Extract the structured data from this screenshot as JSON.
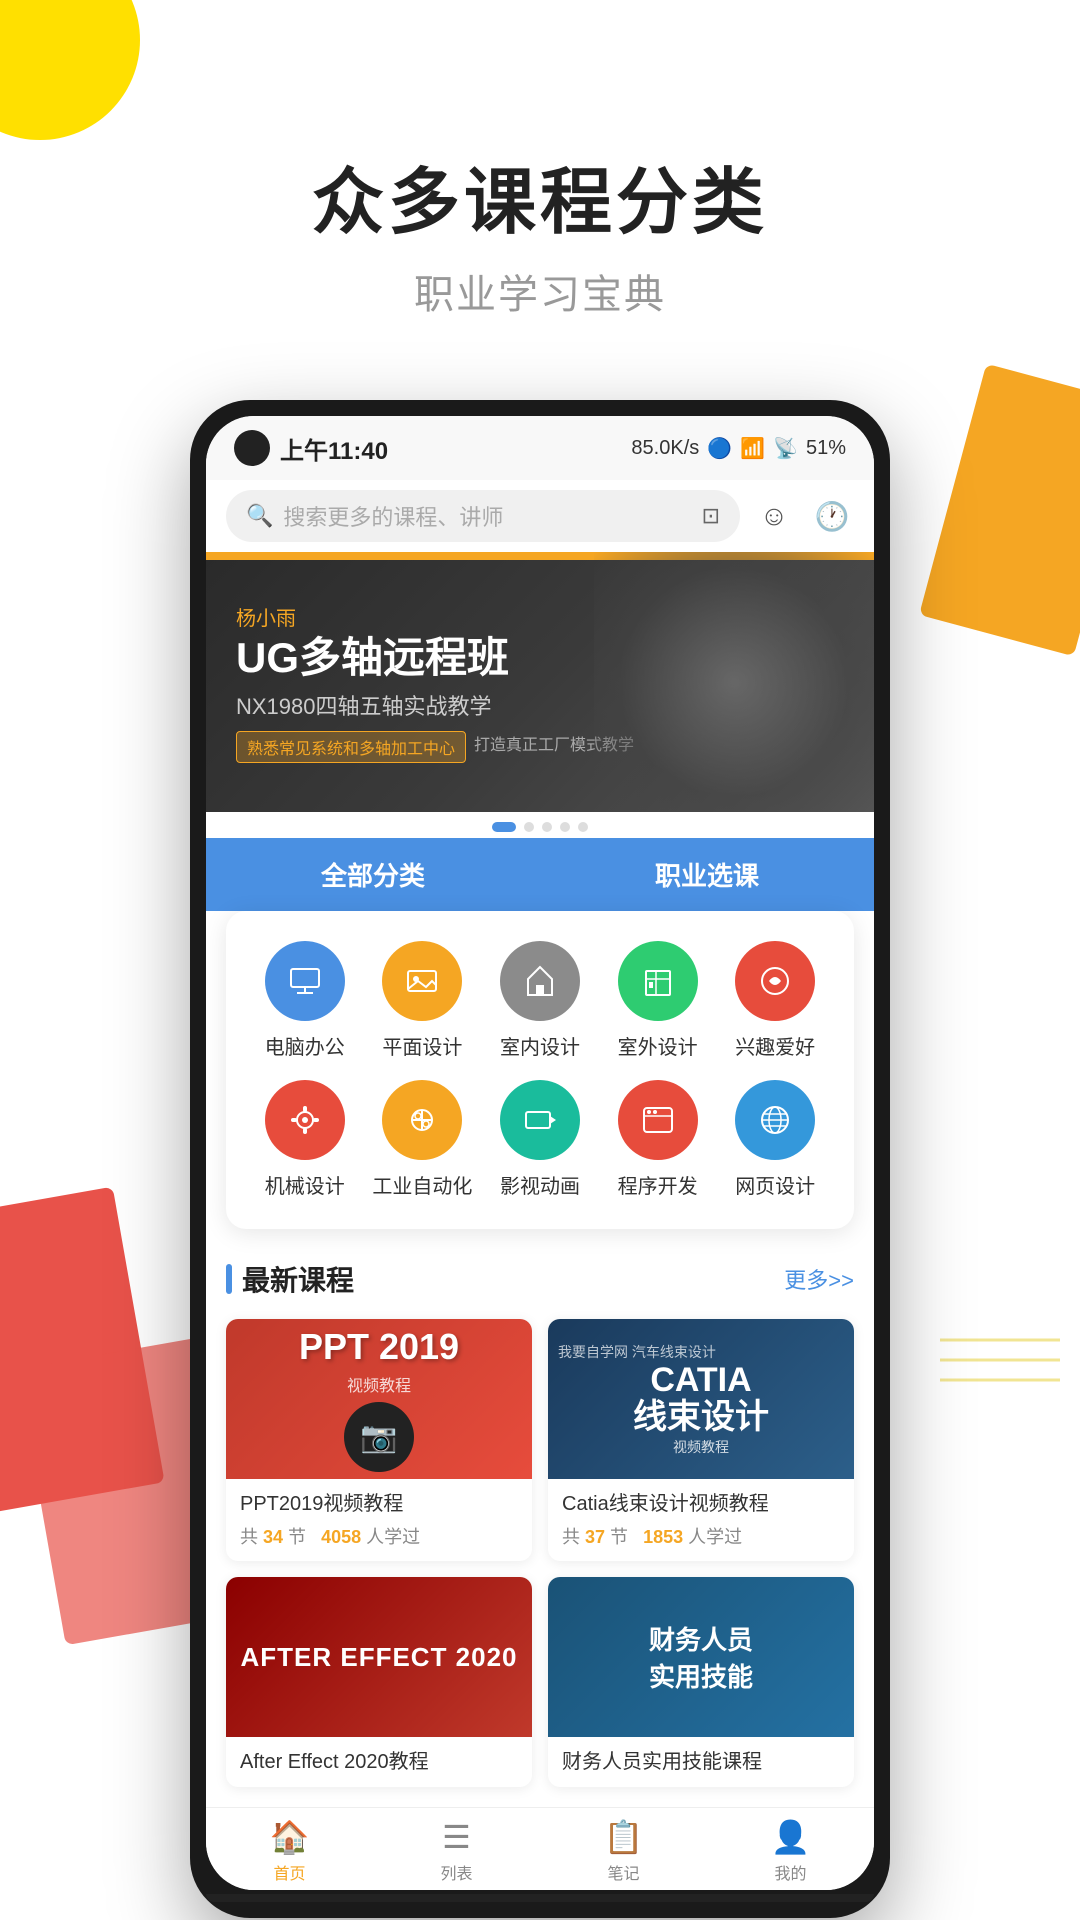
{
  "page": {
    "background": {
      "yellow_circle": "decorative",
      "orange_rect": "decorative",
      "red_rects": "decorative"
    },
    "header": {
      "main_title": "众多课程分类",
      "sub_title": "职业学习宝典"
    },
    "phone": {
      "status_bar": {
        "time": "上午11:40",
        "speed": "85.0K/s",
        "battery": "51%"
      },
      "search": {
        "placeholder": "搜索更多的课程、讲师"
      },
      "banner": {
        "author": "杨小雨",
        "title": "UG多轴远程班",
        "subtitle": "NX1980四轴五轴实战教学",
        "tag1": "熟悉常见系统和多轴加工中心",
        "tag2": "打造真正工厂模式教学",
        "dots_count": 5,
        "active_dot": 0
      },
      "category_buttons": {
        "all": "全部分类",
        "career": "职业选课"
      },
      "categories": [
        {
          "id": "computer-office",
          "label": "电脑办公",
          "icon": "💻",
          "color": "#4A90E2"
        },
        {
          "id": "graphic-design",
          "label": "平面设计",
          "icon": "🖼",
          "color": "#F5A623"
        },
        {
          "id": "interior-design",
          "label": "室内设计",
          "icon": "🏠",
          "color": "#8B8B8B"
        },
        {
          "id": "outdoor-design",
          "label": "室外设计",
          "icon": "🏢",
          "color": "#2ECC71"
        },
        {
          "id": "hobby",
          "label": "兴趣爱好",
          "icon": "🧩",
          "color": "#E74C3C"
        },
        {
          "id": "mechanical",
          "label": "机械设计",
          "icon": "⚙️",
          "color": "#E74C3C"
        },
        {
          "id": "industrial",
          "label": "工业自动化",
          "icon": "🔧",
          "color": "#F5A623"
        },
        {
          "id": "film",
          "label": "影视动画",
          "icon": "🎬",
          "color": "#1ABC9C"
        },
        {
          "id": "programming",
          "label": "程序开发",
          "icon": "💻",
          "color": "#E74C3C"
        },
        {
          "id": "webdesign",
          "label": "网页设计",
          "icon": "🌐",
          "color": "#3498DB"
        }
      ],
      "latest_section": {
        "title": "最新课程",
        "more": "更多>>",
        "courses": [
          {
            "id": "ppt2019",
            "thumb_type": "ppt",
            "name": "PPT2019视频教程",
            "lessons": "34",
            "students": "4058"
          },
          {
            "id": "catia",
            "thumb_type": "catia",
            "name": "Catia线束设计视频教程",
            "lessons": "37",
            "students": "1853"
          },
          {
            "id": "ae2020",
            "thumb_type": "ae",
            "name": "AFTER EFFECT 2020",
            "lessons": "",
            "students": ""
          },
          {
            "id": "finance",
            "thumb_type": "finance",
            "name": "财务人员",
            "lessons": "",
            "students": ""
          }
        ]
      },
      "bottom_nav": [
        {
          "id": "home",
          "label": "首页",
          "icon": "🏠",
          "active": true
        },
        {
          "id": "list",
          "label": "列表",
          "icon": "☰",
          "active": false
        },
        {
          "id": "notes",
          "label": "笔记",
          "icon": "📋",
          "active": false
        },
        {
          "id": "profile",
          "label": "我的",
          "icon": "👤",
          "active": false
        }
      ]
    }
  }
}
